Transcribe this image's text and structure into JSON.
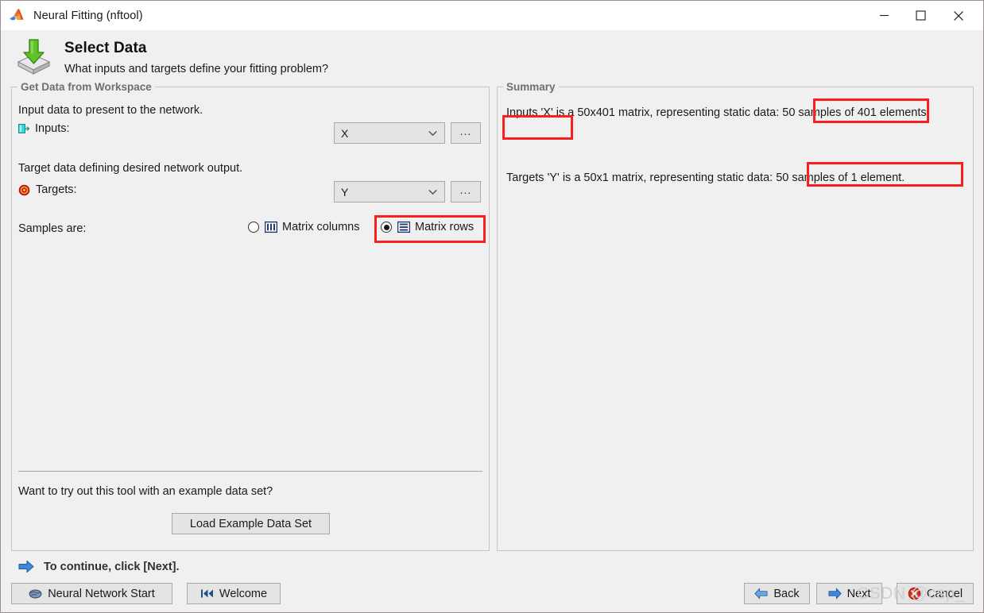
{
  "window": {
    "title": "Neural Fitting (nftool)",
    "logo_icon": "matlab-membrane-logo",
    "minimize_icon": "minimize-icon",
    "maximize_icon": "maximize-icon",
    "close_icon": "close-icon"
  },
  "header": {
    "icon": "import-data-icon",
    "title": "Select Data",
    "subtitle": "What inputs and targets define your fitting problem?"
  },
  "workspace_panel": {
    "legend": "Get Data from Workspace",
    "input_description": "Input data to present to the network.",
    "inputs": {
      "icon": "input-port-icon",
      "label": "Inputs:",
      "value": "X",
      "chevron_icon": "chevron-down-icon",
      "browse_label": "..."
    },
    "target_description": "Target data defining desired network output.",
    "targets": {
      "icon": "target-bullseye-icon",
      "label": "Targets:",
      "value": "Y",
      "chevron_icon": "chevron-down-icon",
      "browse_label": "..."
    },
    "samples_label": "Samples are:",
    "sample_options": [
      {
        "label": "Matrix columns",
        "icon": "matrix-columns-icon",
        "selected": false
      },
      {
        "label": "Matrix rows",
        "icon": "matrix-rows-icon",
        "selected": true
      }
    ],
    "example_prompt": "Want to try out this tool with an example data set?",
    "load_example_label": "Load Example Data Set"
  },
  "summary_panel": {
    "legend": "Summary",
    "inputs_summary": "Inputs 'X' is a 50x401 matrix, representing static data: 50 samples of 401 elements.",
    "targets_summary": "Targets 'Y' is a 50x1 matrix, representing static data: 50 samples of 1 element."
  },
  "annotations": {
    "color": "#fc1f1f",
    "boxes": [
      {
        "name": "highlight-50-samples-of-401"
      },
      {
        "name": "highlight-elements"
      },
      {
        "name": "highlight-50-samples-of-1-element"
      },
      {
        "name": "highlight-matrix-rows-option"
      }
    ]
  },
  "footer": {
    "continue_icon": "arrow-right-icon",
    "continue_text": "To continue, click [Next].",
    "neural_network_start": {
      "label": "Neural Network Start",
      "icon": "brain-icon"
    },
    "welcome": {
      "label": "Welcome",
      "icon": "rewind-icon"
    },
    "back": {
      "label": "Back",
      "icon": "arrow-left-icon"
    },
    "next": {
      "label": "Next",
      "icon": "arrow-right-icon"
    },
    "cancel": {
      "label": "Cancel",
      "icon": "error-x-icon"
    }
  },
  "watermark": {
    "text": "CSDN @csp_"
  }
}
